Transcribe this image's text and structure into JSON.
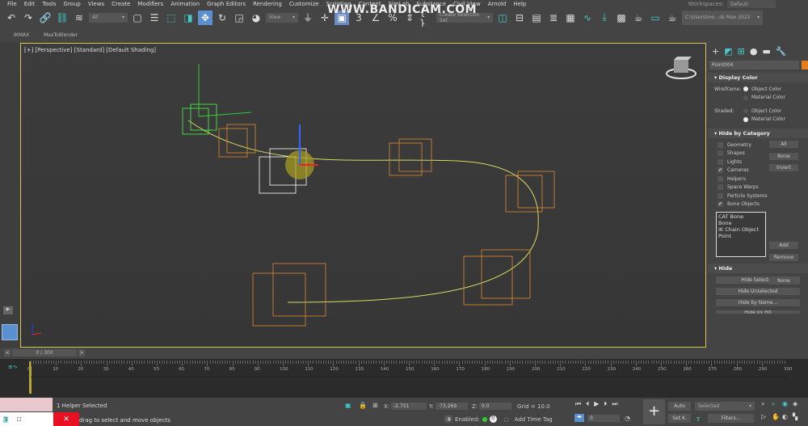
{
  "menu": [
    "File",
    "Edit",
    "Tools",
    "Group",
    "Views",
    "Create",
    "Modifiers",
    "Animation",
    "Graph Editors",
    "Rendering",
    "Customize",
    "Scripting",
    "Content",
    "SimLab",
    "Substance",
    "Civil View",
    "Arnold",
    "Help"
  ],
  "workspaces": {
    "label": "Workspaces:",
    "value": "Default"
  },
  "toolbar": {
    "filter": "All",
    "refcoord": "View",
    "selset": "Create Selection Set",
    "project": "C:\\Users\\mo...ds Max 2022"
  },
  "watermark": "WWW.BANDICAM.COM",
  "tabs2": [
    "IKMAX",
    "MaxToBlender"
  ],
  "viewport": {
    "label": "[+] [Perspective] [Standard] [Default Shading]"
  },
  "cmd": {
    "object_name": "Point004",
    "object_color": "#e87d1e",
    "display_color": {
      "title": "Display Color",
      "wireframe": "Wireframe:",
      "shaded": "Shaded:",
      "object_color": "Object Color",
      "material_color": "Material Color",
      "wire_sel": "object",
      "shaded_sel": "material"
    },
    "hide_by_category": {
      "title": "Hide by Category",
      "items": [
        {
          "label": "Geometry",
          "checked": false
        },
        {
          "label": "Shapes",
          "checked": false
        },
        {
          "label": "Lights",
          "checked": false
        },
        {
          "label": "Cameras",
          "checked": true
        },
        {
          "label": "Helpers",
          "checked": false
        },
        {
          "label": "Space Warps",
          "checked": false
        },
        {
          "label": "Particle Systems",
          "checked": false
        },
        {
          "label": "Bone Objects",
          "checked": true
        }
      ],
      "all": "All",
      "none": "None",
      "invert": "Invert",
      "list": [
        "CAT Bone",
        "Bone",
        "IK Chain Object",
        "Point"
      ],
      "add": "Add",
      "remove": "Remove",
      "none2": "None"
    },
    "hide": {
      "title": "Hide",
      "buttons": [
        "Hide Selected",
        "Hide Unselected",
        "Hide by Name...",
        "Hide by Hit"
      ]
    }
  },
  "time": {
    "frame": "0 / 300",
    "ticks": [
      "0",
      "10",
      "20",
      "30",
      "40",
      "50",
      "60",
      "70",
      "80",
      "90",
      "100",
      "110",
      "120",
      "130",
      "140",
      "150",
      "160",
      "170",
      "180",
      "190",
      "200",
      "210",
      "220",
      "230",
      "240",
      "250",
      "260",
      "270",
      "280",
      "290",
      "300"
    ]
  },
  "status": {
    "selected": "1 Helper Selected",
    "prompt": "Click or click-and-drag to select and move objects",
    "prompt_visible": "drag to select and move objects",
    "x_label": "X:",
    "x": "-2.751",
    "y_label": "Y:",
    "y": "-73.269",
    "z_label": "Z:",
    "z": "0.0",
    "grid": "Grid = 10.0",
    "enabled": "Enabled:",
    "add_time_tag": "Add Time Tag",
    "frame_field": "0",
    "auto": "Auto",
    "setkey": "Set K.",
    "key_filter": "Selected",
    "filters": "Filters...",
    "badge": "3"
  }
}
